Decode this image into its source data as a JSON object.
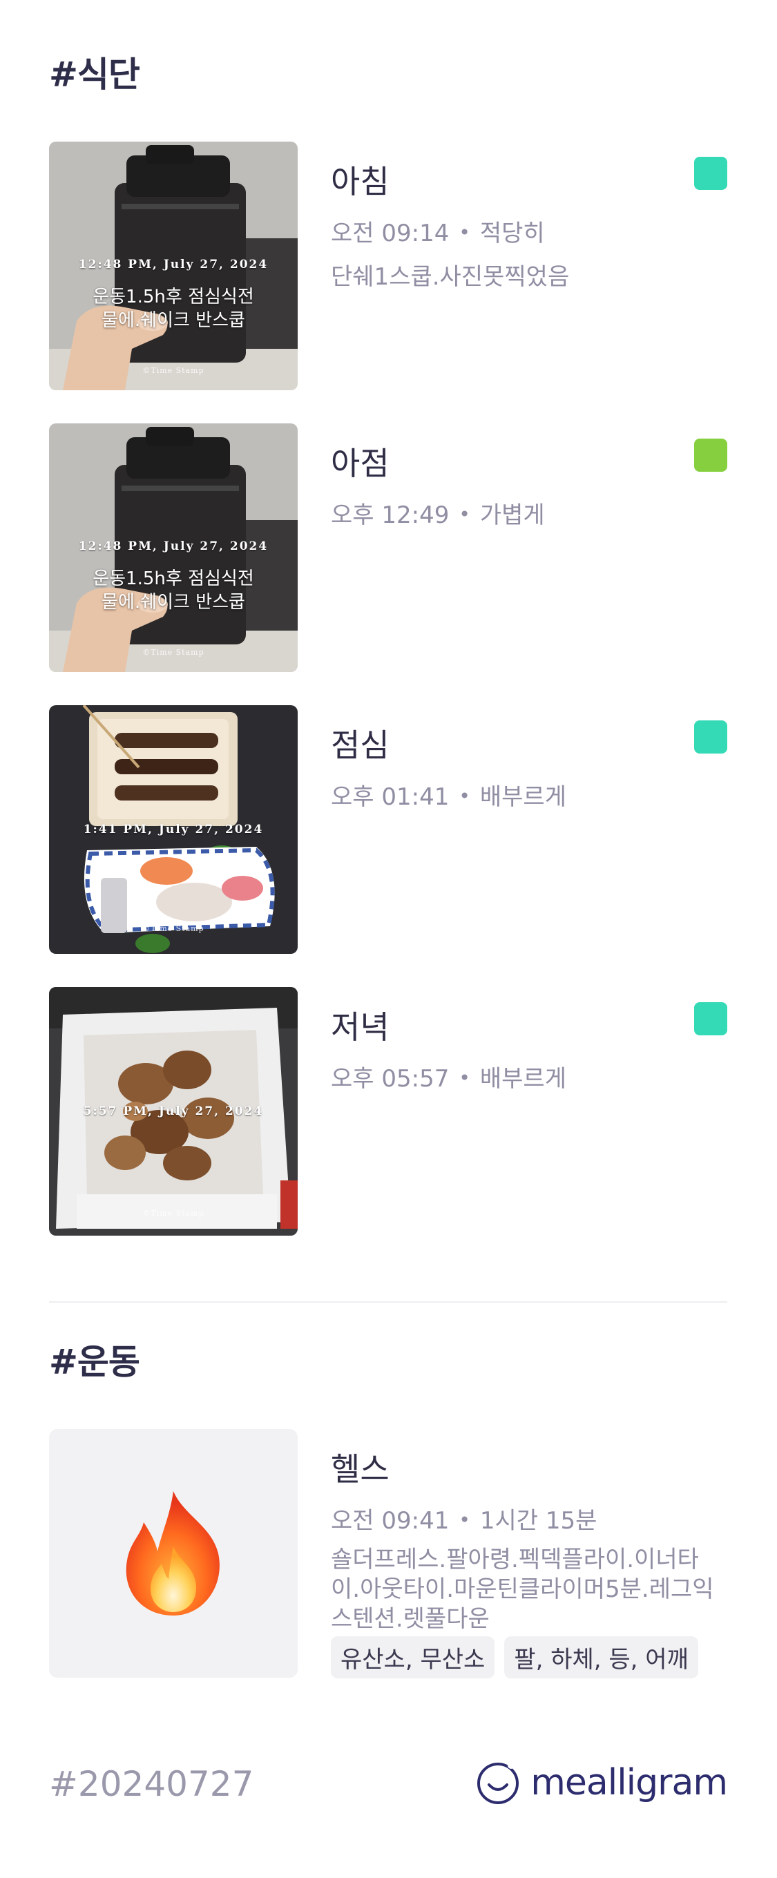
{
  "diet": {
    "title": "#식단",
    "meals": [
      {
        "name": "아침",
        "time": "오전 09:14",
        "portion": "적당히",
        "memo": "단쉐1스쿱.사진못찍었음",
        "tag_color": "#34d9b5",
        "photo": {
          "stamp_date": "12:48 PM, July 27, 2024",
          "note_lines": [
            "운동1.5h후 점심식전",
            "물에.쉐이크 반스쿱"
          ],
          "brand": "©Time Stamp"
        }
      },
      {
        "name": "아점",
        "time": "오후 12:49",
        "portion": "가볍게",
        "memo": "",
        "tag_color": "#86cf3f",
        "photo": {
          "stamp_date": "12:48 PM, July 27, 2024",
          "note_lines": [
            "운동1.5h후 점심식전",
            "물에.쉐이크 반스쿱"
          ],
          "brand": "©Time Stamp"
        }
      },
      {
        "name": "점심",
        "time": "오후 01:41",
        "portion": "배부르게",
        "memo": "",
        "tag_color": "#34d9b5",
        "photo": {
          "stamp_date": "1:41 PM, July 27, 2024",
          "note_lines": [],
          "brand": "©Time Stamp"
        }
      },
      {
        "name": "저녁",
        "time": "오후 05:57",
        "portion": "배부르게",
        "memo": "",
        "tag_color": "#34d9b5",
        "photo": {
          "stamp_date": "5:57 PM, July 27, 2024",
          "note_lines": [],
          "brand": "©Time Stamp"
        }
      }
    ]
  },
  "exercise": {
    "title": "#운동",
    "item": {
      "name": "헬스",
      "time": "오전 09:41",
      "duration": "1시간 15분",
      "memo": "숄더프레스.팔아령.펙덱플라이.이너타이.아웃타이.마운틴클라이머5분.레그익스텐션.렛풀다운",
      "chips": [
        "유산소, 무산소",
        "팔, 하체, 등, 어깨"
      ],
      "icon": "fire-icon"
    }
  },
  "footer": {
    "date": "#20240727",
    "brand": "mealligram"
  }
}
